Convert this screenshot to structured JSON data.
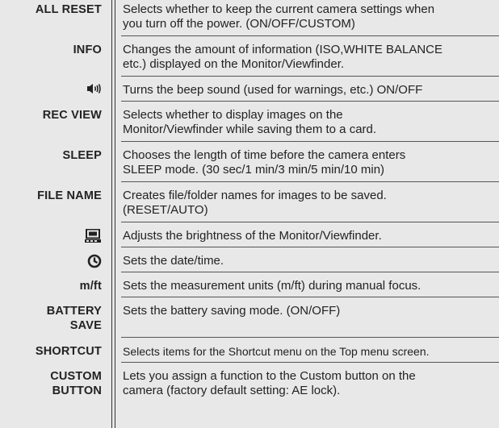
{
  "rows": [
    {
      "label": "ALL RESET",
      "desc1": "Selects whether to keep the current camera settings when",
      "desc2": "you turn off the power. (ON/OFF/CUSTOM)"
    },
    {
      "label": "INFO",
      "desc1": "Changes the amount of information (ISO,WHITE BALANCE",
      "desc2": "etc.) displayed on the Monitor/Viewfinder."
    },
    {
      "label": "",
      "icon": "beep-icon",
      "desc1": "Turns the beep sound (used for warnings, etc.) ON/OFF"
    },
    {
      "label": "REC VIEW",
      "desc1": "Selects whether to display images on the",
      "desc2": "Monitor/Viewfinder while saving them to a card."
    },
    {
      "label": "SLEEP",
      "desc1": "Chooses the length of time before the camera enters",
      "desc2": "SLEEP mode. (30 sec/1 min/3 min/5 min/10 min)"
    },
    {
      "label": "FILE NAME",
      "desc1": "Creates file/folder names for images to be saved.",
      "desc2": "(RESET/AUTO)"
    },
    {
      "label": "",
      "icon": "monitor-brightness-icon",
      "desc1": "Adjusts the brightness of the Monitor/Viewfinder."
    },
    {
      "label": "",
      "icon": "clock-icon",
      "desc1": "Sets the date/time."
    },
    {
      "label": "m/ft",
      "desc1": "Sets the measurement units (m/ft) during manual focus."
    },
    {
      "label1": "BATTERY",
      "label2": "SAVE",
      "desc1": "Sets the battery saving mode. (ON/OFF)"
    },
    {
      "label": "SHORTCUT",
      "desc1": "Selects items for the Shortcut menu on the Top menu screen."
    },
    {
      "label1": "CUSTOM",
      "label2": "BUTTON",
      "desc1": "Lets you assign a function to the Custom button on the",
      "desc2": "camera (factory default setting: AE lock)."
    }
  ]
}
